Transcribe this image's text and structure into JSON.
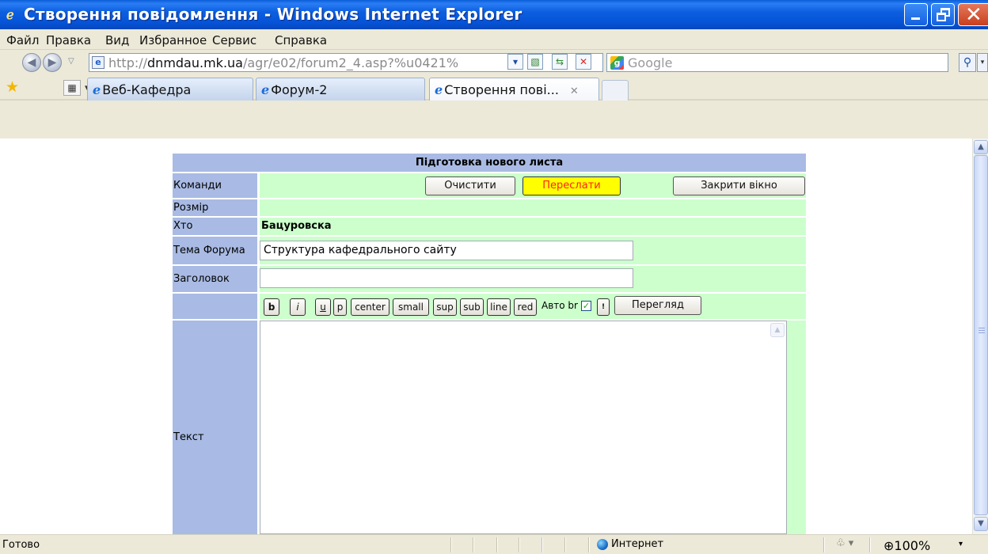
{
  "window": {
    "title": "Створення повідомлення - Windows Internet Explorer"
  },
  "menu": [
    "Файл",
    "Правка",
    "Вид",
    "Избранное",
    "Сервис",
    "Справка"
  ],
  "address": {
    "url_prefix": "http://",
    "url_host": "dnmdau.mk.ua",
    "url_path": "/agr/e02/forum2_4.asp?%u0421%",
    "search_placeholder": "Google"
  },
  "tabs": [
    {
      "label": "Веб-Кафедра",
      "active": false
    },
    {
      "label": "Форум-2",
      "active": false
    },
    {
      "label": "Створення пові...",
      "active": true
    }
  ],
  "form": {
    "header": "Підготовка нового листа",
    "rows": {
      "commands_label": "Команди",
      "size_label": "Розмір",
      "who_label": "Хто",
      "who_value": "Бацуровска",
      "topic_label": "Тема Форума",
      "topic_value": "Структура кафедрального сайту",
      "heading_label": "Заголовок",
      "heading_value": "",
      "text_label": "Текст"
    },
    "buttons": {
      "clear": "Очистити",
      "send": "Переслати",
      "close": "Закрити вікно",
      "preview": "Перегляд"
    },
    "format_buttons": [
      "b",
      "i",
      "u",
      "p",
      "center",
      "small",
      "sup",
      "sub",
      "line",
      "red"
    ],
    "auto_br_label": "Авто br",
    "auto_br_checked": true,
    "extra_button": "!"
  },
  "status": {
    "text": "Готово",
    "zone": "Интернет",
    "zoom": "100%"
  },
  "colors": {
    "label_bg": "#a9bbe4",
    "value_bg": "#ccffcc",
    "send_bg": "#ffff00",
    "send_fg": "#ff2020"
  }
}
